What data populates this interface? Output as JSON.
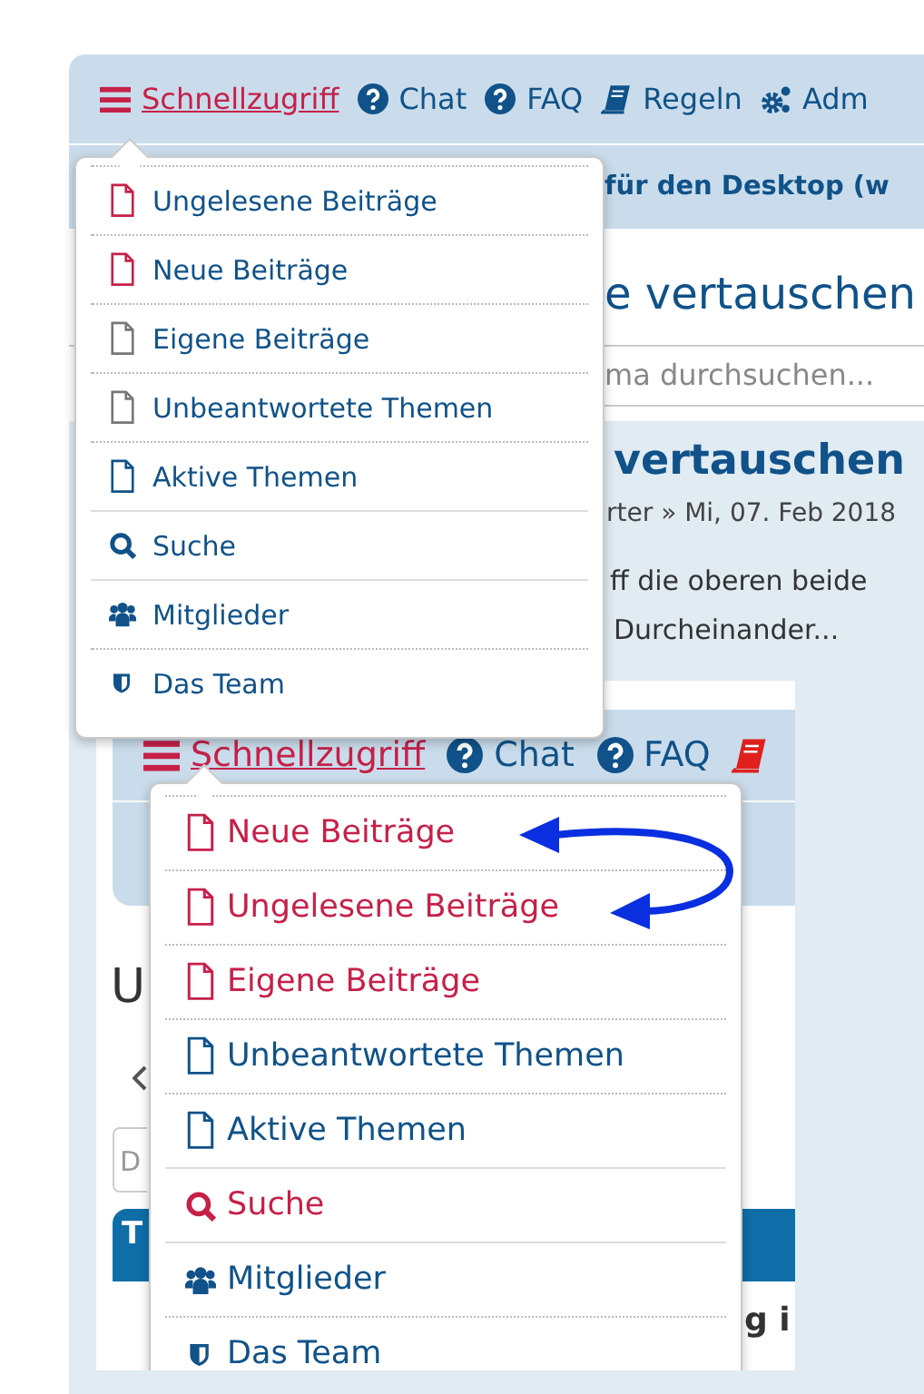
{
  "navbar": {
    "items": [
      {
        "label": "Schnellzugriff",
        "kind": "menu"
      },
      {
        "label": "Chat",
        "kind": "help"
      },
      {
        "label": "FAQ",
        "kind": "help"
      },
      {
        "label": "Regeln",
        "kind": "book"
      },
      {
        "label": "Adm",
        "kind": "gears"
      }
    ]
  },
  "subheader": "für den Desktop (w",
  "page_title": "e vertauschen",
  "search": {
    "placeholder": "ma durchsuchen..."
  },
  "post": {
    "title": "vertauschen",
    "meta": "rter » Mi, 07. Feb 2018",
    "lines": [
      "ff die oberen beide",
      "Durcheinander..."
    ]
  },
  "quick_menu": {
    "items": [
      {
        "label": "Ungelesene Beiträge",
        "kind": "file",
        "color": "#c62049"
      },
      {
        "label": "Neue Beiträge",
        "kind": "file",
        "color": "#c62049"
      },
      {
        "label": "Eigene Beiträge",
        "kind": "file",
        "color": "#777777"
      },
      {
        "label": "Unbeantwortete Themen",
        "kind": "file",
        "color": "#777777"
      },
      {
        "label": "Aktive Themen",
        "kind": "file",
        "color": "#105289"
      },
      {
        "label": "Suche",
        "kind": "search",
        "color": "#105289",
        "section_start": true
      },
      {
        "label": "Mitglieder",
        "kind": "group",
        "color": "#105289",
        "section_start": true
      },
      {
        "label": "Das Team",
        "kind": "shield",
        "color": "#105289"
      }
    ]
  },
  "embedded_screenshot": {
    "navbar": {
      "items": [
        {
          "label": "Schnellzugriff",
          "kind": "menu"
        },
        {
          "label": "Chat",
          "kind": "help"
        },
        {
          "label": "FAQ",
          "kind": "help"
        },
        {
          "kind": "book"
        }
      ]
    },
    "title_fragment": "U",
    "field_fragment": "D",
    "bar_fragment": "T",
    "right_fragment": "g i",
    "quick_menu": {
      "items": [
        {
          "label": "Neue Beiträge",
          "kind": "file",
          "color": "#c62049"
        },
        {
          "label": "Ungelesene Beiträge",
          "kind": "file",
          "color": "#c62049"
        },
        {
          "label": "Eigene Beiträge",
          "kind": "file",
          "color": "#c62049"
        },
        {
          "label": "Unbeantwortete Themen",
          "kind": "file",
          "color": "#105289"
        },
        {
          "label": "Aktive Themen",
          "kind": "file",
          "color": "#105289"
        },
        {
          "label": "Suche",
          "kind": "search",
          "color": "#c62049",
          "section_start": true
        },
        {
          "label": "Mitglieder",
          "kind": "group",
          "color": "#105289",
          "section_start": true
        },
        {
          "label": "Das Team",
          "kind": "shield",
          "color": "#105289"
        }
      ]
    }
  }
}
